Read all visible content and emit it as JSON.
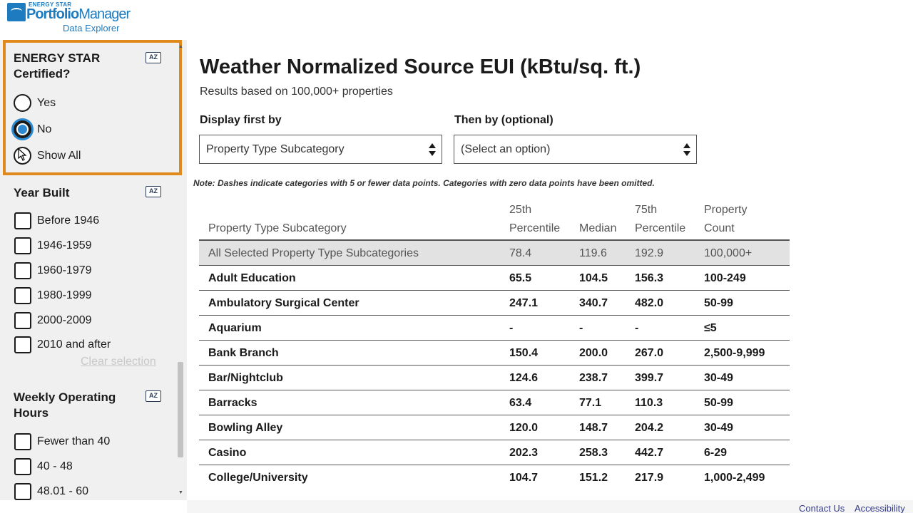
{
  "header": {
    "logo_energy_star": "ENERGY STAR",
    "logo_portfolio": "Portfolio",
    "logo_manager": "Manager",
    "logo_sub": "Data Explorer"
  },
  "sidebar": {
    "certified": {
      "title": "ENERGY STAR Certified?",
      "sort_icon": "AZ",
      "options": [
        "Yes",
        "No",
        "Show All"
      ],
      "selected": "No"
    },
    "year_built": {
      "title": "Year Built",
      "sort_icon": "AZ",
      "options": [
        "Before 1946",
        "1946-1959",
        "1960-1979",
        "1980-1999",
        "2000-2009",
        "2010 and after"
      ],
      "clear_label": "Clear selection"
    },
    "weekly_hours": {
      "title": "Weekly Operating Hours",
      "sort_icon": "AZ",
      "options": [
        "Fewer than 40",
        "40 - 48",
        "48.01 - 60"
      ]
    }
  },
  "main": {
    "title": "Weather Normalized Source EUI (kBtu/sq. ft.)",
    "subtitle": "Results based on 100,000+ properties",
    "display_first_label": "Display first by",
    "display_first_value": "Property Type Subcategory",
    "then_by_label": "Then by (optional)",
    "then_by_value": "(Select an option)",
    "note": "Note: Dashes indicate categories with 5 or fewer data points. Categories with zero data points have been omitted."
  },
  "table": {
    "headers": {
      "category": "Property Type Subcategory",
      "p25_line1": "25th",
      "p25_line2": "Percentile",
      "median": "Median",
      "p75_line1": "75th",
      "p75_line2": "Percentile",
      "count_line1": "Property",
      "count_line2": "Count"
    },
    "rows": [
      {
        "name": "All Selected Property Type Subcategories",
        "p25": "78.4",
        "median": "119.6",
        "p75": "192.9",
        "count": "100,000+"
      },
      {
        "name": "Adult Education",
        "p25": "65.5",
        "median": "104.5",
        "p75": "156.3",
        "count": "100-249"
      },
      {
        "name": "Ambulatory Surgical Center",
        "p25": "247.1",
        "median": "340.7",
        "p75": "482.0",
        "count": "50-99"
      },
      {
        "name": "Aquarium",
        "p25": "-",
        "median": "-",
        "p75": "-",
        "count": "≤5"
      },
      {
        "name": "Bank Branch",
        "p25": "150.4",
        "median": "200.0",
        "p75": "267.0",
        "count": "2,500-9,999"
      },
      {
        "name": "Bar/Nightclub",
        "p25": "124.6",
        "median": "238.7",
        "p75": "399.7",
        "count": "30-49"
      },
      {
        "name": "Barracks",
        "p25": "63.4",
        "median": "77.1",
        "p75": "110.3",
        "count": "50-99"
      },
      {
        "name": "Bowling Alley",
        "p25": "120.0",
        "median": "148.7",
        "p75": "204.2",
        "count": "30-49"
      },
      {
        "name": "Casino",
        "p25": "202.3",
        "median": "258.3",
        "p75": "442.7",
        "count": "6-29"
      },
      {
        "name": "College/University",
        "p25": "104.7",
        "median": "151.2",
        "p75": "217.9",
        "count": "1,000-2,499"
      }
    ]
  },
  "footer": {
    "contact": "Contact Us",
    "accessibility": "Accessibility"
  },
  "colors": {
    "highlight": "#e08a1e",
    "brand": "#1e7bbf",
    "radio_selected": "#2e8ad0"
  }
}
